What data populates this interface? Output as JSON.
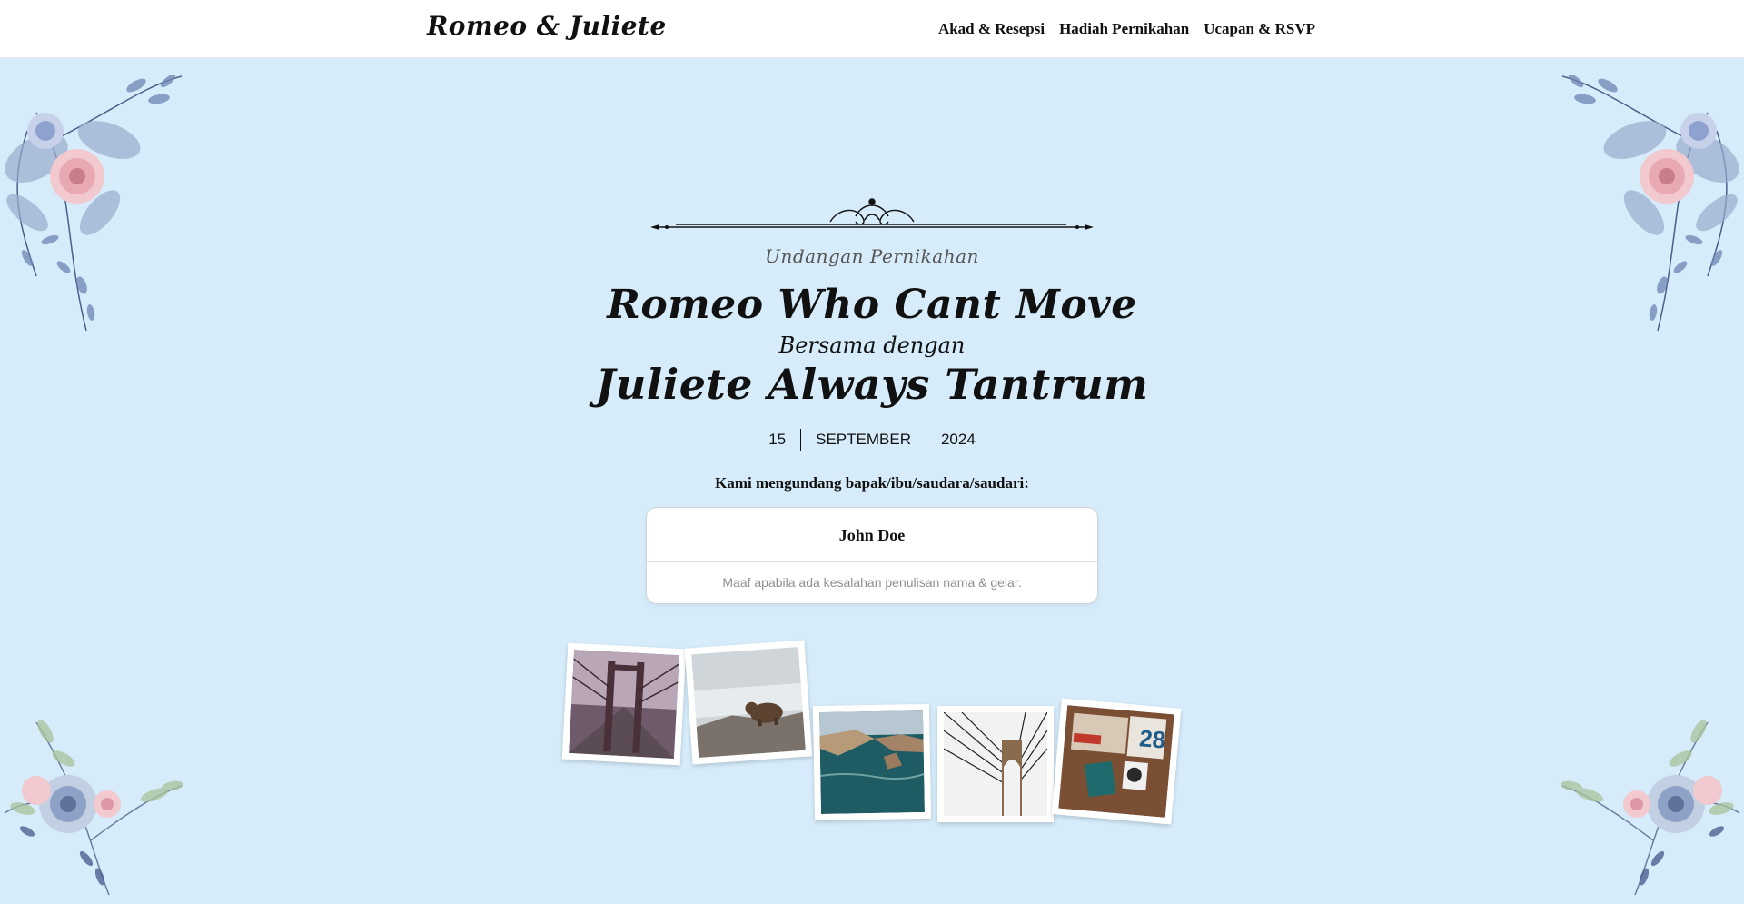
{
  "header": {
    "brand": "Romeo & Juliete",
    "nav": [
      "Akad & Resepsi",
      "Hadiah Pernikahan",
      "Ucapan & RSVP"
    ]
  },
  "hero": {
    "subtitle": "Undangan Pernikahan",
    "groom": "Romeo Who Cant Move",
    "with": "Bersama dengan",
    "bride": "Juliete Always Tantrum",
    "date": {
      "day": "15",
      "month": "SEPTEMBER",
      "year": "2024"
    },
    "invite_text": "Kami mengundang bapak/ibu/saudara/saudari:",
    "guest": {
      "name": "John Doe",
      "note": "Maaf apabila ada kesalahan penulisan nama & gelar."
    },
    "photos": [
      "bridge-photo",
      "bear-photo",
      "coastline-photo",
      "bridge-cables-photo",
      "desk-photo"
    ]
  },
  "colors": {
    "hero_bg": "#d6ecfa",
    "header_bg": "#ffffff",
    "text": "#111111",
    "note": "#8a8f94"
  }
}
